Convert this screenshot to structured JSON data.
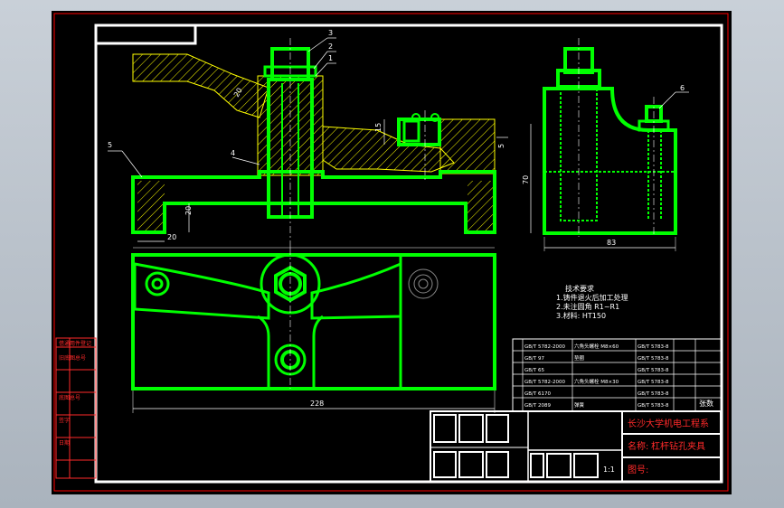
{
  "colors": {
    "background": "#000000",
    "frame": "#ffffff",
    "outline": "#00ff00",
    "hatch": "#ffff00",
    "dimension": "#ffffff",
    "table_text": "#ff2a2a"
  },
  "callouts": {
    "c3": "3",
    "c2": "2",
    "c1": "1",
    "c5": "5",
    "c4": "4",
    "c6": "6"
  },
  "dimensions": {
    "d20_bottom": "20",
    "d20_side": "20",
    "d15": "15",
    "d5": "5",
    "d70": "70",
    "d83": "83",
    "d228": "228"
  },
  "tech": {
    "title": "技术要求",
    "line1": "1.铸件退火后加工处理",
    "line2": "2.未注圆角 R1~R1",
    "line3": "3.材料: HT150"
  },
  "parts": [
    {
      "code": "GB/T 5782-2000",
      "name": "六角头螺栓 M8×60",
      "std": "GB/T 5783-8"
    },
    {
      "code": "GB/T 97",
      "name": "垫圈",
      "std": "GB/T 5783-8"
    },
    {
      "code": "GB/T 65",
      "name": "",
      "std": "GB/T 5783-8"
    },
    {
      "code": "GB/T 5782-2000",
      "name": "六角头螺栓 M8×30",
      "std": "GB/T 5783-8"
    },
    {
      "code": "GB/T 6170",
      "name": "",
      "std": "GB/T 5783-8"
    },
    {
      "code": "GB/T 2089",
      "name": "弹簧",
      "std": "GB/T 5783-8"
    }
  ],
  "title_block": {
    "school": "长沙大学机电工程系",
    "name_label": "名称:",
    "name_value": "杠杆钻孔夹具",
    "drawing_no_label": "图号:",
    "count_label": "张数",
    "scale_value": "1:1"
  },
  "left_strip": [
    "借通用件登记",
    "旧底图总号",
    "底图总号",
    "签字",
    "日期"
  ]
}
